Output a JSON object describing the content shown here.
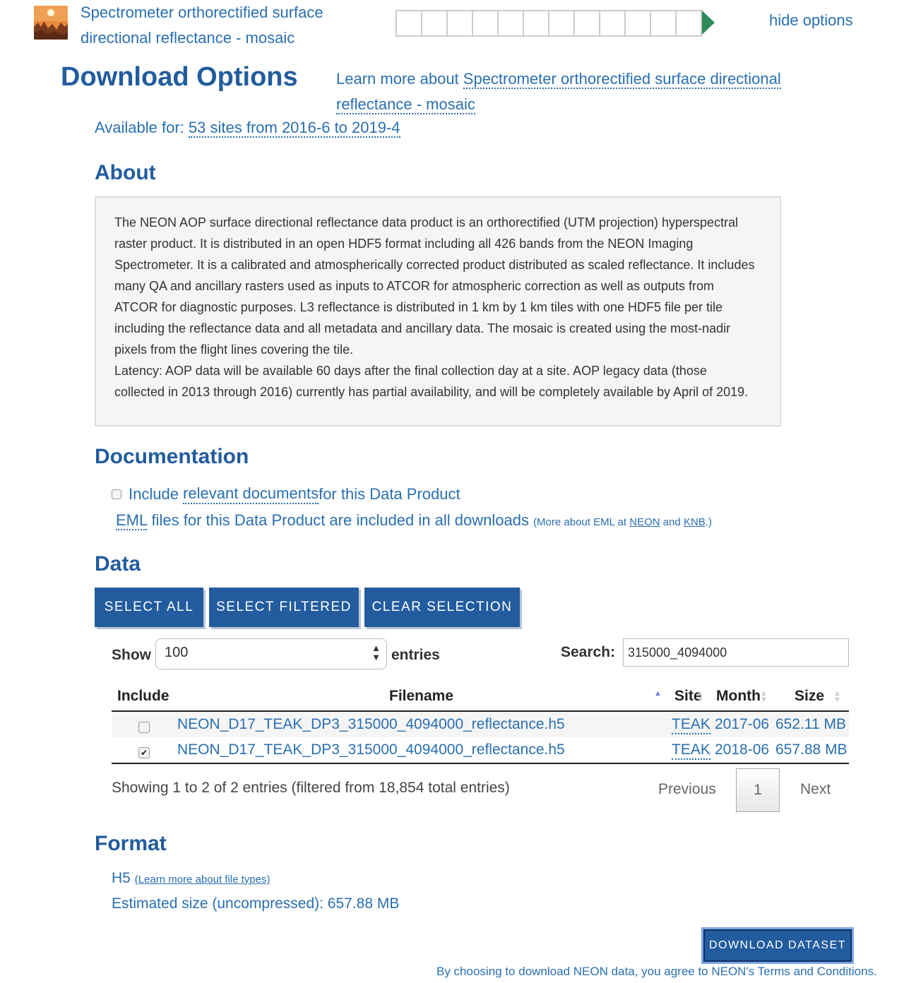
{
  "header": {
    "title_link": "Spectrometer orthorectified surface directional reflectance - mosaic",
    "progress": {
      "segments": 12,
      "filled": 0
    },
    "hide_options": "hide options"
  },
  "download_options": {
    "heading": "Download Options",
    "learn_more_prefix": "Learn more about ",
    "learn_more_link": "Spectrometer orthorectified surface directional reflectance - mosaic",
    "available_prefix": "Available for: ",
    "available_link": "53 sites from 2016-6 to 2019-4"
  },
  "about": {
    "heading": "About",
    "paragraph1": "The NEON AOP surface directional reflectance data product is an orthorectified (UTM projection) hyperspectral raster product. It is distributed in an open HDF5 format including all 426 bands from the NEON Imaging Spectrometer. It is a calibrated and atmospherically corrected product distributed as scaled reflectance. It includes many QA and ancillary rasters used as inputs to ATCOR for atmospheric correction as well as outputs from ATCOR for diagnostic purposes. L3 reflectance is distributed in 1 km by 1 km tiles with one HDF5 file per tile including the reflectance data and all metadata and ancillary data. The mosaic is created using the most-nadir pixels from the flight lines covering the tile.",
    "paragraph2": "Latency: AOP data will be available 60 days after the final collection day at a site. AOP legacy data (those collected in 2013 through 2016) currently has partial availability, and will be completely available by April of 2019."
  },
  "documentation": {
    "heading": "Documentation",
    "include_prefix": "Include ",
    "include_link": "relevant documents",
    "include_suffix": " for this Data Product",
    "include_checked": false,
    "eml_link": "EML",
    "eml_text": " files for this Data Product are included in all downloads",
    "eml_note_prefix": "(More about EML at ",
    "eml_neon": "NEON",
    "eml_and": " and ",
    "eml_knb": "KNB",
    "eml_note_suffix": ".)"
  },
  "data": {
    "heading": "Data",
    "buttons": {
      "select_all": "SELECT ALL",
      "select_filtered": "SELECT FILTERED",
      "clear_selection": "CLEAR SELECTION"
    },
    "show_label": "Show",
    "entries_value": "100",
    "entries_label": "entries",
    "search_label": "Search:",
    "search_value": "315000_4094000",
    "columns": [
      "Include",
      "Filename",
      "Site",
      "Month",
      "Size"
    ],
    "rows": [
      {
        "checked": false,
        "filename": "NEON_D17_TEAK_DP3_315000_4094000_reflectance.h5",
        "site": "TEAK",
        "month": "2017-06",
        "size": "652.11 MB"
      },
      {
        "checked": true,
        "filename": "NEON_D17_TEAK_DP3_315000_4094000_reflectance.h5",
        "site": "TEAK",
        "month": "2018-06",
        "size": "657.88 MB"
      }
    ],
    "showing": "Showing 1 to 2 of 2 entries (filtered from 18,854 total entries)",
    "pagination": {
      "previous": "Previous",
      "page": "1",
      "next": "Next"
    }
  },
  "format": {
    "heading": "Format",
    "type": "H5",
    "learn_more": "(Learn more about file types)",
    "estimated_size": "Estimated size (uncompressed): 657.88 MB"
  },
  "download": {
    "button": "DOWNLOAD DATASET",
    "terms": "By choosing to download NEON data, you agree to NEON's Terms and Conditions."
  },
  "colors": {
    "heading": "#225c9e",
    "link": "#2a6fb0",
    "button": "#225c9e",
    "progress_arrow": "#2e8b57"
  }
}
